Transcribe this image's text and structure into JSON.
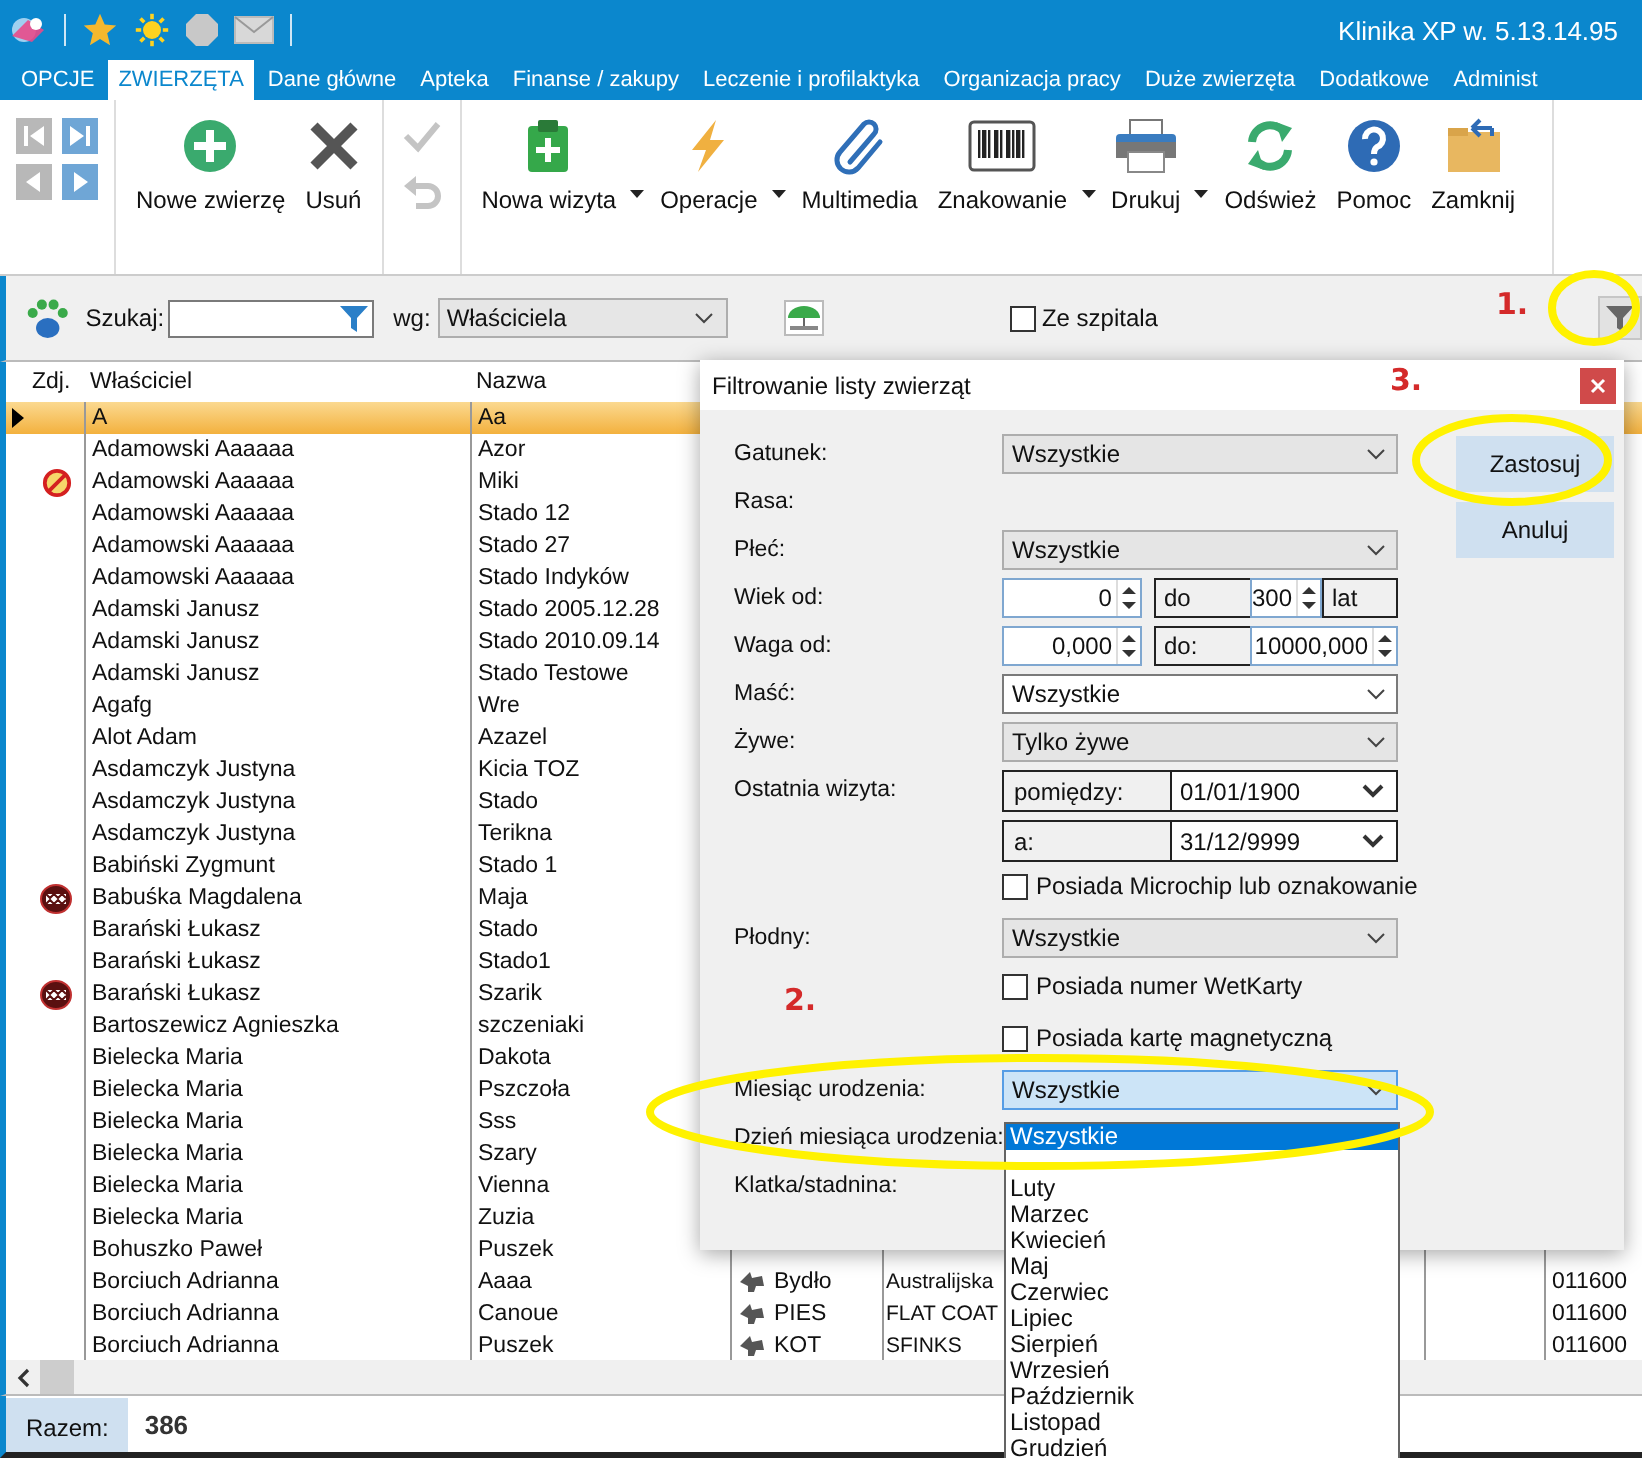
{
  "titlebar": {
    "title": "Klinika XP w. 5.13.14.95"
  },
  "tabs": [
    {
      "label": "OPCJE",
      "selected": false
    },
    {
      "label": "ZWIERZĘTA",
      "selected": true
    },
    {
      "label": "Dane główne",
      "selected": false
    },
    {
      "label": "Apteka",
      "selected": false
    },
    {
      "label": "Finanse / zakupy",
      "selected": false
    },
    {
      "label": "Leczenie i profilaktyka",
      "selected": false
    },
    {
      "label": "Organizacja pracy",
      "selected": false
    },
    {
      "label": "Duże zwierzęta",
      "selected": false
    },
    {
      "label": "Dodatkowe",
      "selected": false
    },
    {
      "label": "Administ",
      "selected": false
    }
  ],
  "nav_buttons": [
    {
      "disabled": true
    },
    {
      "disabled": false
    },
    {
      "disabled": true
    },
    {
      "disabled": false
    }
  ],
  "toolbar_main": [
    {
      "label": "Nowe zwierzę"
    },
    {
      "label": "Usuń"
    }
  ],
  "edit_buttons": [
    {
      "disabled": true
    },
    {
      "disabled": true
    }
  ],
  "toolbar": [
    {
      "label": "Nowa wizyta",
      "has_menu": true
    },
    {
      "label": "Operacje",
      "has_menu": true
    },
    {
      "label": "Multimedia",
      "has_menu": false
    },
    {
      "label": "Znakowanie",
      "has_menu": true
    },
    {
      "label": "Drukuj",
      "has_menu": true
    },
    {
      "label": "Odśwież",
      "has_menu": false
    },
    {
      "label": "Pomoc",
      "has_menu": false
    },
    {
      "label": "Zamknij",
      "has_menu": false
    }
  ],
  "search": {
    "label": "Szukaj:",
    "by_label": "wg:",
    "by_value": "Właściciela",
    "hospital": {
      "label": "Ze szpitala",
      "checked": false
    }
  },
  "table": {
    "columns": [
      "Zdj.",
      "Właściciel",
      "Nazwa"
    ],
    "rows": [
      {
        "owner": "A",
        "name": "Aa",
        "selected": true
      },
      {
        "owner": "Adamowski Aaaaaa",
        "name": "Azor",
        "selected": false
      },
      {
        "owner": "Adamowski Aaaaaa",
        "name": "Miki",
        "selected": false,
        "banned": true
      },
      {
        "owner": "Adamowski Aaaaaa",
        "name": "Stado 12",
        "selected": false
      },
      {
        "owner": "Adamowski Aaaaaa",
        "name": "Stado 27",
        "selected": false
      },
      {
        "owner": "Adamowski Aaaaaa",
        "name": "Stado Indyków",
        "selected": false
      },
      {
        "owner": "Adamski Janusz",
        "name": "Stado 2005.12.28",
        "selected": false
      },
      {
        "owner": "Adamski Janusz",
        "name": "Stado 2010.09.14",
        "selected": false
      },
      {
        "owner": "Adamski Janusz",
        "name": "Stado Testowe",
        "selected": false
      },
      {
        "owner": "Agafg",
        "name": "Wre",
        "selected": false
      },
      {
        "owner": "Alot  Adam",
        "name": "Azazel",
        "selected": false
      },
      {
        "owner": "Asdamczyk  Justyna",
        "name": "Kicia TOZ",
        "selected": false
      },
      {
        "owner": "Asdamczyk  Justyna",
        "name": "Stado",
        "selected": false
      },
      {
        "owner": "Asdamczyk  Justyna",
        "name": "Terikna",
        "selected": false
      },
      {
        "owner": "Babiński Zygmunt",
        "name": "Stado 1",
        "selected": false
      },
      {
        "owner": "Babuśka  Magdalena",
        "name": "Maja",
        "selected": false,
        "aggressive": true
      },
      {
        "owner": "Barański Łukasz",
        "name": "Stado",
        "selected": false
      },
      {
        "owner": "Barański Łukasz",
        "name": "Stado1",
        "selected": false
      },
      {
        "owner": "Barański Łukasz",
        "name": "Szarik",
        "selected": false,
        "aggressive": true
      },
      {
        "owner": "Bartoszewicz  Agnieszka",
        "name": "szczeniaki",
        "selected": false
      },
      {
        "owner": "Bielecka Maria",
        "name": "Dakota",
        "selected": false
      },
      {
        "owner": "Bielecka Maria",
        "name": "Pszczoła",
        "selected": false
      },
      {
        "owner": "Bielecka Maria",
        "name": "Sss",
        "selected": false
      },
      {
        "owner": "Bielecka Maria",
        "name": "Szary",
        "selected": false
      },
      {
        "owner": "Bielecka Maria",
        "name": "Vienna",
        "selected": false
      },
      {
        "owner": "Bielecka Maria",
        "name": "Zuzia",
        "selected": false
      },
      {
        "owner": "Bohuszko Paweł",
        "name": "Puszek",
        "selected": false
      },
      {
        "owner": "Borciuch  Adrianna",
        "name": "Aaaa",
        "selected": false,
        "species": "Bydło",
        "breed": "Australijska",
        "code": "011600"
      },
      {
        "owner": "Borciuch  Adrianna",
        "name": "Canoue",
        "selected": false,
        "species": "PIES",
        "breed": "FLAT COAT",
        "code": "011600"
      },
      {
        "owner": "Borciuch  Adrianna",
        "name": "Puszek",
        "selected": false,
        "species": "KOT",
        "breed": "SFINKS",
        "code": "011600"
      }
    ]
  },
  "footer": {
    "total_label": "Razem:",
    "total": "386"
  },
  "dialog": {
    "title": "Filtrowanie listy zwierząt",
    "buttons": [
      "Zastosuj",
      "Anuluj"
    ],
    "fields": [
      {
        "kind": "select",
        "label": "Gatunek:",
        "value": "Wszystkie",
        "editable": false,
        "open": false
      },
      {
        "kind": "label",
        "label": "Rasa:"
      },
      {
        "kind": "select",
        "label": "Płeć:",
        "value": "Wszystkie",
        "editable": false,
        "open": false
      },
      {
        "kind": "spin",
        "label": "Wiek od:",
        "from": "0",
        "to_label": "do",
        "to": "300",
        "unit": "lat"
      },
      {
        "kind": "spin",
        "label": "Waga od:",
        "from": "0,000",
        "to_label": "do:",
        "to": "10000,000"
      },
      {
        "kind": "select",
        "label": "Maść:",
        "value": "Wszystkie",
        "editable": true,
        "open": false
      },
      {
        "kind": "select",
        "label": "Żywe:",
        "value": "Tylko żywe",
        "editable": false,
        "open": false
      },
      {
        "kind": "dates",
        "label": "Ostatnia wizyta:",
        "ranges": [
          {
            "label": "pomiędzy:",
            "value": "01/01/1900"
          },
          {
            "label": "a:",
            "value": "31/12/9999"
          }
        ]
      },
      {
        "kind": "checkbox",
        "label": "Posiada Microchip lub oznakowanie",
        "checked": false
      },
      {
        "kind": "select",
        "label": "Płodny:",
        "value": "Wszystkie",
        "editable": false,
        "open": false
      },
      {
        "kind": "checkbox",
        "label": "Posiada numer WetKarty",
        "checked": false
      },
      {
        "kind": "checkbox",
        "label": "Posiada kartę magnetyczną",
        "checked": false
      },
      {
        "kind": "select",
        "label": "Miesiąc urodzenia:",
        "value": "Wszystkie",
        "editable": false,
        "open": true
      },
      {
        "kind": "label",
        "label": "Dzień miesiąca urodzenia:"
      },
      {
        "kind": "label",
        "label": "Klatka/stadnina:"
      }
    ],
    "month_options": [
      {
        "label": "Wszystkie",
        "selected": true
      },
      {
        "selected": false
      },
      {
        "label": "Luty",
        "selected": false
      },
      {
        "label": "Marzec",
        "selected": false
      },
      {
        "label": "Kwiecień",
        "selected": false
      },
      {
        "label": "Maj",
        "selected": false
      },
      {
        "label": "Czerwiec",
        "selected": false
      },
      {
        "label": "Lipiec",
        "selected": false
      },
      {
        "label": "Sierpień",
        "selected": false
      },
      {
        "label": "Wrzesień",
        "selected": false
      },
      {
        "label": "Październik",
        "selected": false
      },
      {
        "label": "Listopad",
        "selected": false
      },
      {
        "label": "Grudzień",
        "selected": false
      }
    ]
  },
  "annotations": [
    "1.",
    "2.",
    "3."
  ]
}
